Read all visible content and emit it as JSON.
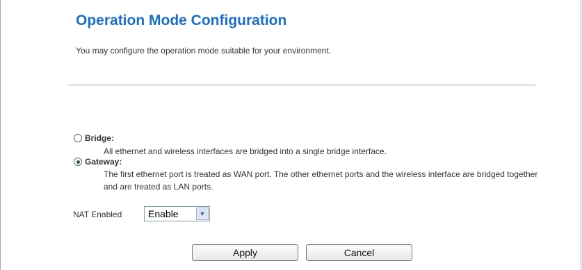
{
  "page": {
    "title": "Operation Mode Configuration",
    "intro": "You may configure the operation mode suitable for your environment."
  },
  "modes": [
    {
      "label": "Bridge:",
      "description": "All ethernet and wireless interfaces are bridged into a single bridge interface.",
      "selected": false
    },
    {
      "label": "Gateway:",
      "description": "The first ethernet port is treated as WAN port. The other ethernet ports and the wireless interface are bridged together and are treated as LAN ports.",
      "selected": true
    }
  ],
  "nat": {
    "label": "NAT Enabled",
    "value": "Enable"
  },
  "buttons": {
    "apply": "Apply",
    "cancel": "Cancel"
  },
  "colors": {
    "title": "#1c6fc8",
    "text": "#333333",
    "divider": "#a0a0a0"
  }
}
